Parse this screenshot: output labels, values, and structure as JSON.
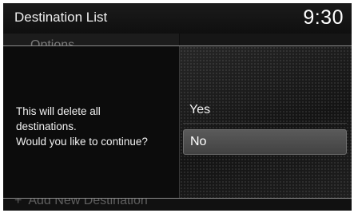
{
  "header": {
    "title": "Destination List",
    "time": "9:30"
  },
  "background_list": {
    "options_label": "Options",
    "add_destination_label": "Add New Destination",
    "add_icon": "+"
  },
  "dialog": {
    "message_lines": [
      "This will delete all",
      "destinations.",
      "Would you like to continue?"
    ],
    "yes_label": "Yes",
    "no_label": "No",
    "selected": "No"
  },
  "colors": {
    "background": "#0e0e0e",
    "selected_button": "#4a4a4a",
    "text": "#f2f2f2"
  }
}
